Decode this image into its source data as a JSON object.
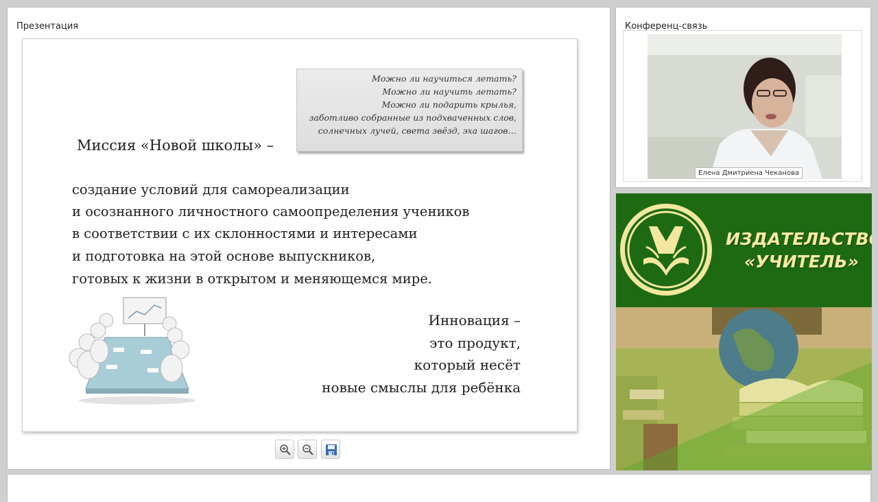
{
  "presentation": {
    "title": "Презентация",
    "slide": {
      "quote_lines": [
        "Можно ли научиться летать?",
        "Можно ли научить летать?",
        "Можно ли подарить крылья,",
        "заботливо собранные из подхваченных слов,",
        "солнечных лучей, света звёзд, эха шагов…"
      ],
      "mission_title": "Миссия «Новой школы» –",
      "body_lines": [
        "создание условий для самореализации",
        "и осознанного личностного самоопределения учеников",
        "в соответствии с их склонностями и интересами",
        "и подготовка на этой основе выпускников,",
        "готовых к жизни в открытом и меняющемся мире."
      ],
      "innovation_lines": [
        "Инновация –",
        "это продукт,",
        "который несёт",
        "новые смыслы для ребёнка"
      ]
    },
    "toolbar": {
      "icons": [
        "zoom-in-icon",
        "zoom-out-icon",
        "save-icon"
      ]
    }
  },
  "conference": {
    "title": "Конференц-связь",
    "participant_name": "Елена Дмитриена Чеканова"
  },
  "banner": {
    "line1": "ИЗДАТЕЛЬСТВО",
    "line2": "«УЧИТЕЛЬ»",
    "colors": {
      "green": "#1e6a13",
      "text": "#f6eaa3"
    }
  }
}
